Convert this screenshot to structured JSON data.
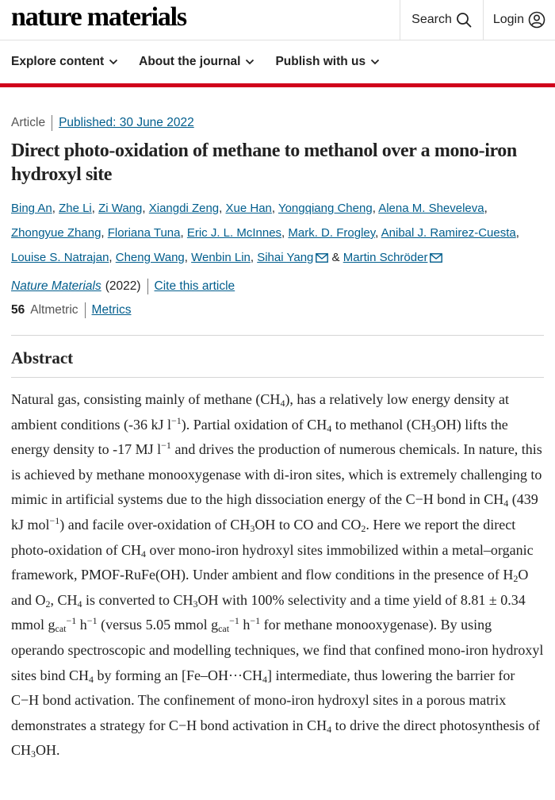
{
  "header": {
    "brand": "nature materials",
    "search_label": "Search",
    "login_label": "Login"
  },
  "nav": {
    "items": [
      {
        "label": "Explore content"
      },
      {
        "label": "About the journal"
      },
      {
        "label": "Publish with us"
      }
    ]
  },
  "article": {
    "type": "Article",
    "published": "Published: 30 June 2022",
    "title": "Direct photo-oxidation of methane to methanol over a mono-iron hydroxyl site",
    "authors": [
      "Bing An",
      "Zhe Li",
      "Zi Wang",
      "Xiangdi Zeng",
      "Xue Han",
      "Yongqiang Cheng",
      "Alena M. Sheveleva",
      "Zhongyue Zhang",
      "Floriana Tuna",
      "Eric J. L. McInnes",
      "Mark. D. Frogley",
      "Anibal J. Ramirez-Cuesta",
      "Louise S. Natrajan",
      "Cheng Wang",
      "Wenbin Lin",
      "Sihai Yang",
      "Martin Schröder"
    ],
    "journal": "Nature Materials",
    "year": "(2022)",
    "cite_label": "Cite this article",
    "altmetric_score": "56",
    "altmetric_label": "Altmetric",
    "metrics_label": "Metrics"
  },
  "abstract": {
    "heading": "Abstract"
  },
  "colors": {
    "link": "#025e8d",
    "accent_bar": "#d0021b"
  }
}
